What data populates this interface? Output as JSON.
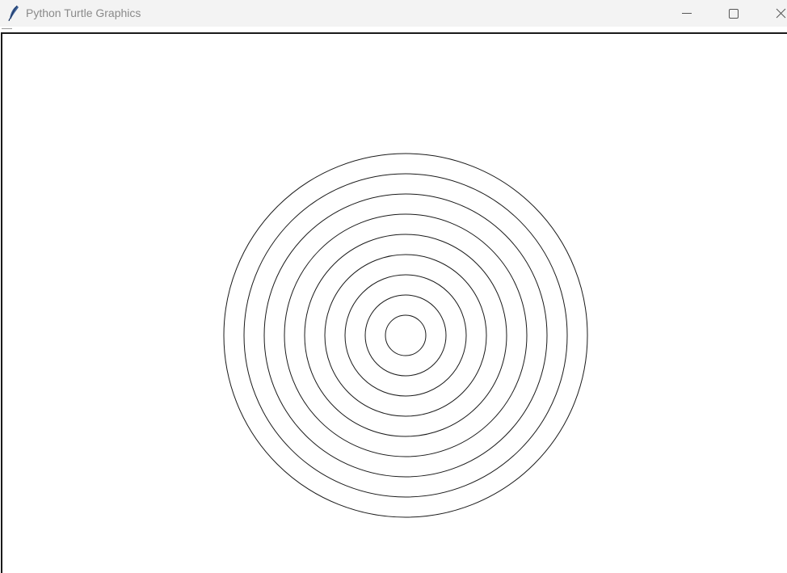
{
  "window": {
    "title": "Python Turtle Graphics",
    "icon": "feather-icon"
  },
  "controls": {
    "minimize_icon": "minimize-icon",
    "maximize_icon": "maximize-icon",
    "close_icon": "close-icon"
  },
  "drawing": {
    "shape": "concentric circles",
    "circle_count": 9,
    "radius_step": 25,
    "stroke_color": "#1a1a1a",
    "background": "#ffffff"
  }
}
